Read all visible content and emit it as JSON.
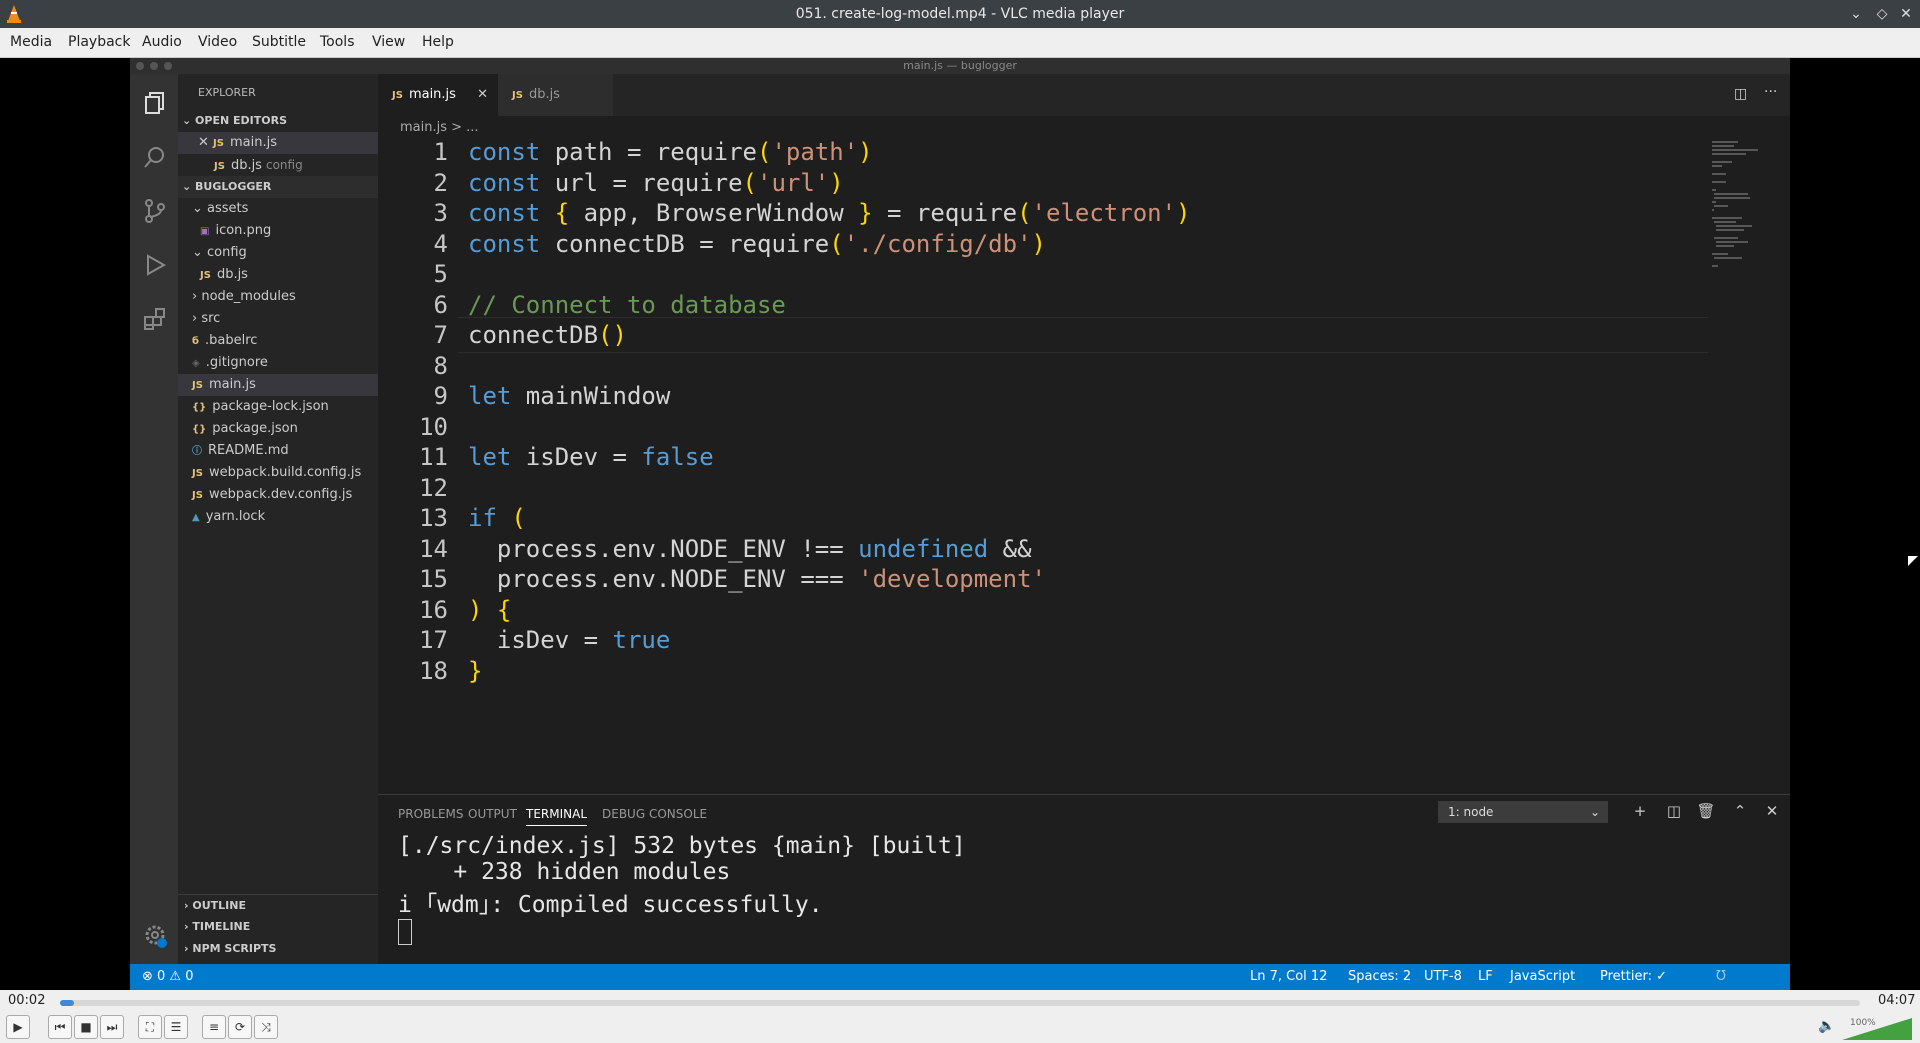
{
  "window": {
    "title": "051. create-log-model.mp4 - VLC media player"
  },
  "menu": [
    "Media",
    "Playback",
    "Audio",
    "Video",
    "Subtitle",
    "Tools",
    "View",
    "Help"
  ],
  "vscode": {
    "title": "main.js — buglogger",
    "explorer_label": "EXPLORER",
    "open_editors_label": "OPEN EDITORS",
    "open_editors": [
      {
        "name": "main.js",
        "detail": ""
      },
      {
        "name": "db.js",
        "detail": "config"
      }
    ],
    "project_label": "BUGLOGGER",
    "tree": [
      "assets",
      "icon.png",
      "config",
      "db.js",
      "node_modules",
      "src",
      ".babelrc",
      ".gitignore",
      "main.js",
      "package-lock.json",
      "package.json",
      "README.md",
      "webpack.build.config.js",
      "webpack.dev.config.js",
      "yarn.lock"
    ],
    "bottom_sections": [
      "OUTLINE",
      "TIMELINE",
      "NPM SCRIPTS"
    ],
    "tabs": [
      "main.js",
      "db.js"
    ],
    "breadcrumb": "main.js > ...",
    "code_lines": [
      "const path = require('path')",
      "const url = require('url')",
      "const { app, BrowserWindow } = require('electron')",
      "const connectDB = require('./config/db')",
      "",
      "// Connect to database",
      "connectDB()",
      "",
      "let mainWindow",
      "",
      "let isDev = false",
      "",
      "if (",
      "  process.env.NODE_ENV !== undefined &&",
      "  process.env.NODE_ENV === 'development'",
      ") {",
      "  isDev = true",
      "}"
    ],
    "panel_tabs": [
      "PROBLEMS",
      "OUTPUT",
      "TERMINAL",
      "DEBUG CONSOLE"
    ],
    "terminal_select": "1: node",
    "terminal_lines": [
      "[./src/index.js] 532 bytes {main} [built]",
      "    + 238 hidden modules",
      "i ｢wdm｣: Compiled successfully."
    ],
    "status": {
      "problems": "⊗ 0 ⚠ 0",
      "position": "Ln 7, Col 12",
      "spaces": "Spaces: 2",
      "encoding": "UTF-8",
      "eol": "LF",
      "language": "JavaScript",
      "prettier": "Prettier: ✓"
    }
  },
  "player": {
    "elapsed": "00:02",
    "total": "04:07",
    "progress": 0.008,
    "volume": "100%"
  }
}
